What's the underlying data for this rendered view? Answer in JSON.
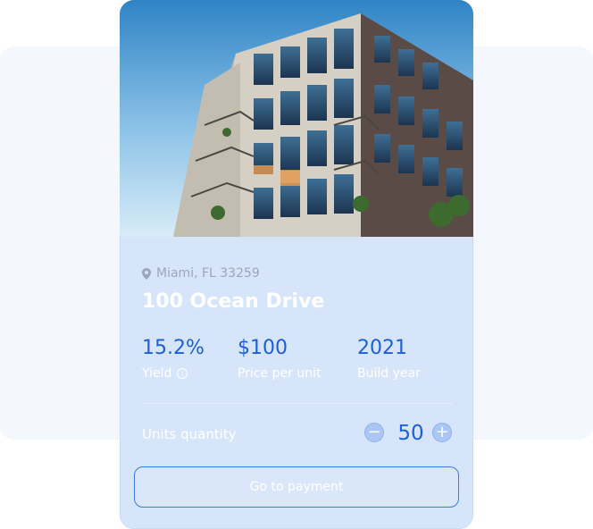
{
  "property": {
    "location": "Miami, FL 33259",
    "title": "100 Ocean Drive",
    "image_alt": "Modern apartment building"
  },
  "stats": [
    {
      "value": "15.2%",
      "label": "Yield"
    },
    {
      "value": "$100",
      "label": "Price per unit"
    },
    {
      "value": "2021",
      "label": "Build year"
    }
  ],
  "quantity": {
    "label": "Units quantity",
    "value": 50,
    "decrement_symbol": "−",
    "increment_symbol": "+"
  },
  "cta": {
    "label": "Go to payment"
  },
  "icons": {
    "location": "map-pin-icon",
    "info": "info-icon",
    "minus": "minus-icon",
    "plus": "plus-icon"
  },
  "colors": {
    "accent": "#1c5fd6",
    "card_bg": "#d7e5fb",
    "backdrop": "#f4f7fd"
  }
}
